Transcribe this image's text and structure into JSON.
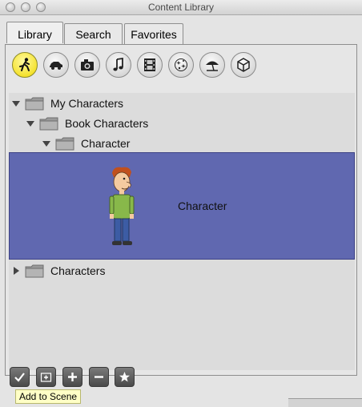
{
  "window": {
    "title": "Content Library"
  },
  "tabs": [
    {
      "label": "Library",
      "active": true
    },
    {
      "label": "Search",
      "active": false
    },
    {
      "label": "Favorites",
      "active": false
    }
  ],
  "categories": [
    {
      "icon": "running-figure-icon",
      "selected": true
    },
    {
      "icon": "car-icon",
      "selected": false
    },
    {
      "icon": "camera-icon",
      "selected": false
    },
    {
      "icon": "music-note-icon",
      "selected": false
    },
    {
      "icon": "film-icon",
      "selected": false
    },
    {
      "icon": "sparkles-icon",
      "selected": false
    },
    {
      "icon": "beach-umbrella-icon",
      "selected": false
    },
    {
      "icon": "cube-icon",
      "selected": false
    }
  ],
  "tree": {
    "my_characters": "My Characters",
    "book_characters": "Book Characters",
    "character_folder": "Character",
    "selected_item": "Character",
    "characters": "Characters"
  },
  "colors": {
    "selection": "#6068b0",
    "category_selected": "#f0d800"
  },
  "bottom_toolbar": {
    "buttons": [
      "checkmark-icon",
      "new-folder-icon",
      "plus-icon",
      "minus-icon",
      "star-icon"
    ],
    "tooltip": "Add to Scene"
  }
}
